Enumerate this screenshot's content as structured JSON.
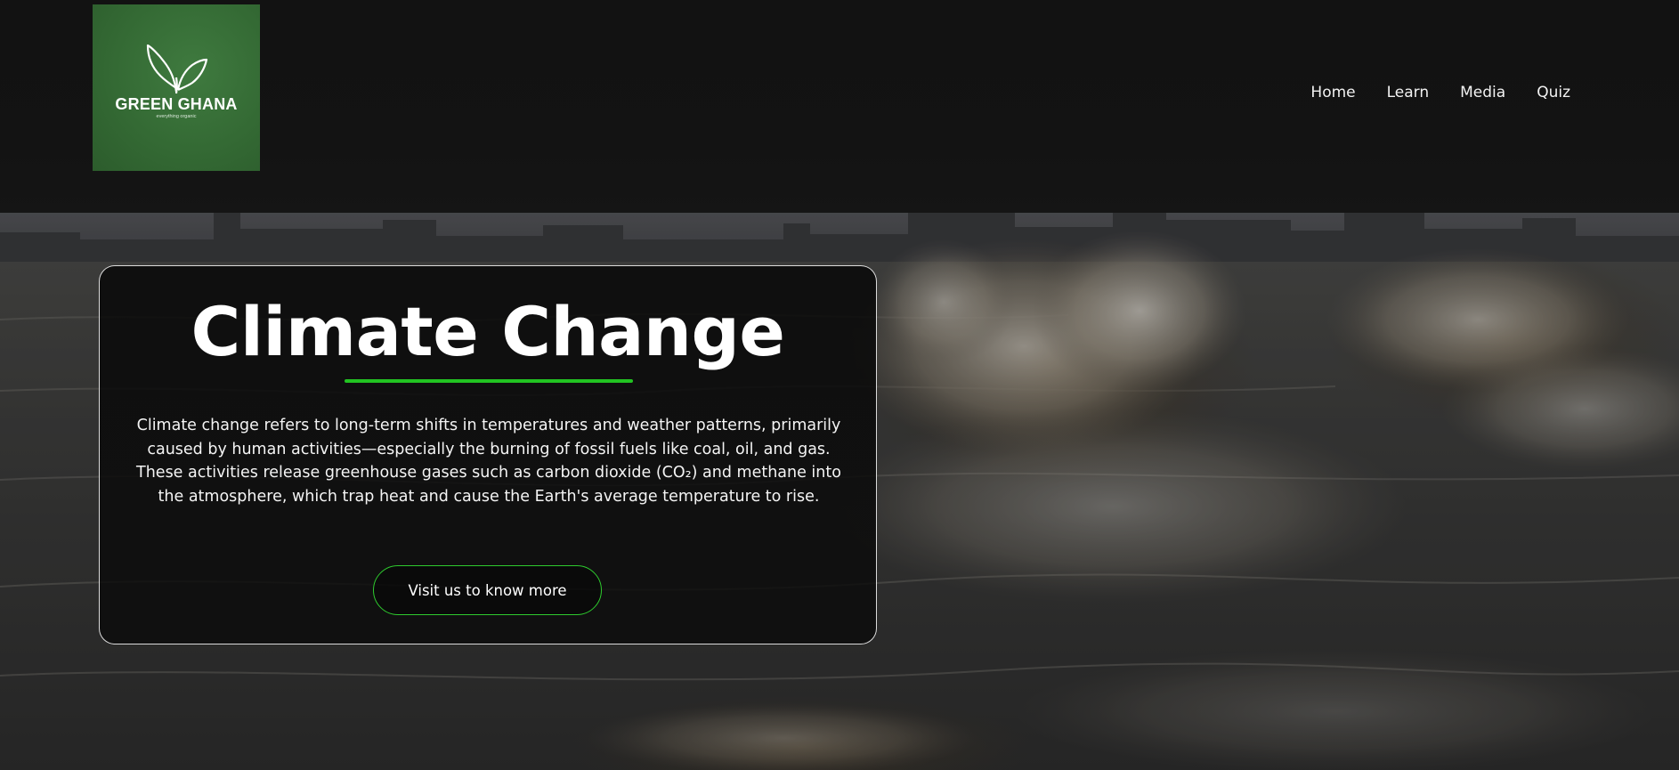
{
  "header": {
    "logo": {
      "name": "GREEN GHANA",
      "tagline": "everything organic",
      "icon": "leaf-sprout-icon",
      "background_color": "#356b35"
    },
    "nav": [
      {
        "label": "Home"
      },
      {
        "label": "Learn"
      },
      {
        "label": "Media"
      },
      {
        "label": "Quiz"
      }
    ]
  },
  "hero": {
    "background": "stormy-sea-waves-city-skyline-photo",
    "title": "Climate Change",
    "accent_color": "#22c322",
    "description": "Climate change refers to long-term shifts in temperatures and weather patterns, primarily caused by human activities—especially the burning of fossil fuels like coal, oil, and gas. These activities release greenhouse gases such as carbon dioxide (CO₂) and methane into the atmosphere, which trap heat and cause the Earth's average temperature to rise.",
    "cta_label": "Visit us to know more"
  }
}
